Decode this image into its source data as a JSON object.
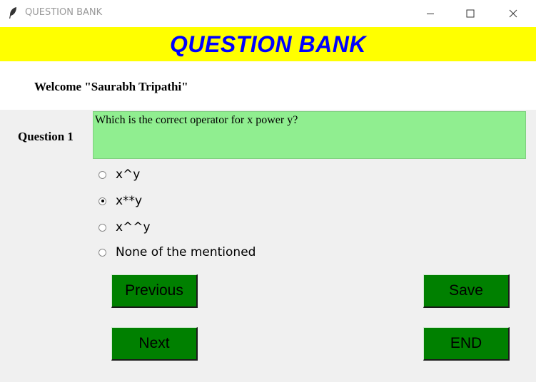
{
  "window": {
    "title": "QUESTION BANK",
    "icon": "feather-icon"
  },
  "banner": {
    "title": "QUESTION BANK",
    "background": "#ffff00",
    "color": "#0000ff"
  },
  "welcome": {
    "text": "Welcome \"Saurabh Tripathi\""
  },
  "question": {
    "label": "Question 1",
    "text": "Which is the correct operator for x power y?",
    "background": "#90ee90"
  },
  "options": [
    {
      "label": "x^y",
      "selected": false
    },
    {
      "label": "x**y",
      "selected": true
    },
    {
      "label": "x^^y",
      "selected": false
    },
    {
      "label": "None of the mentioned",
      "selected": false
    }
  ],
  "buttons": {
    "previous": "Previous",
    "save": "Save",
    "next": "Next",
    "end": "END",
    "background": "#008000"
  }
}
